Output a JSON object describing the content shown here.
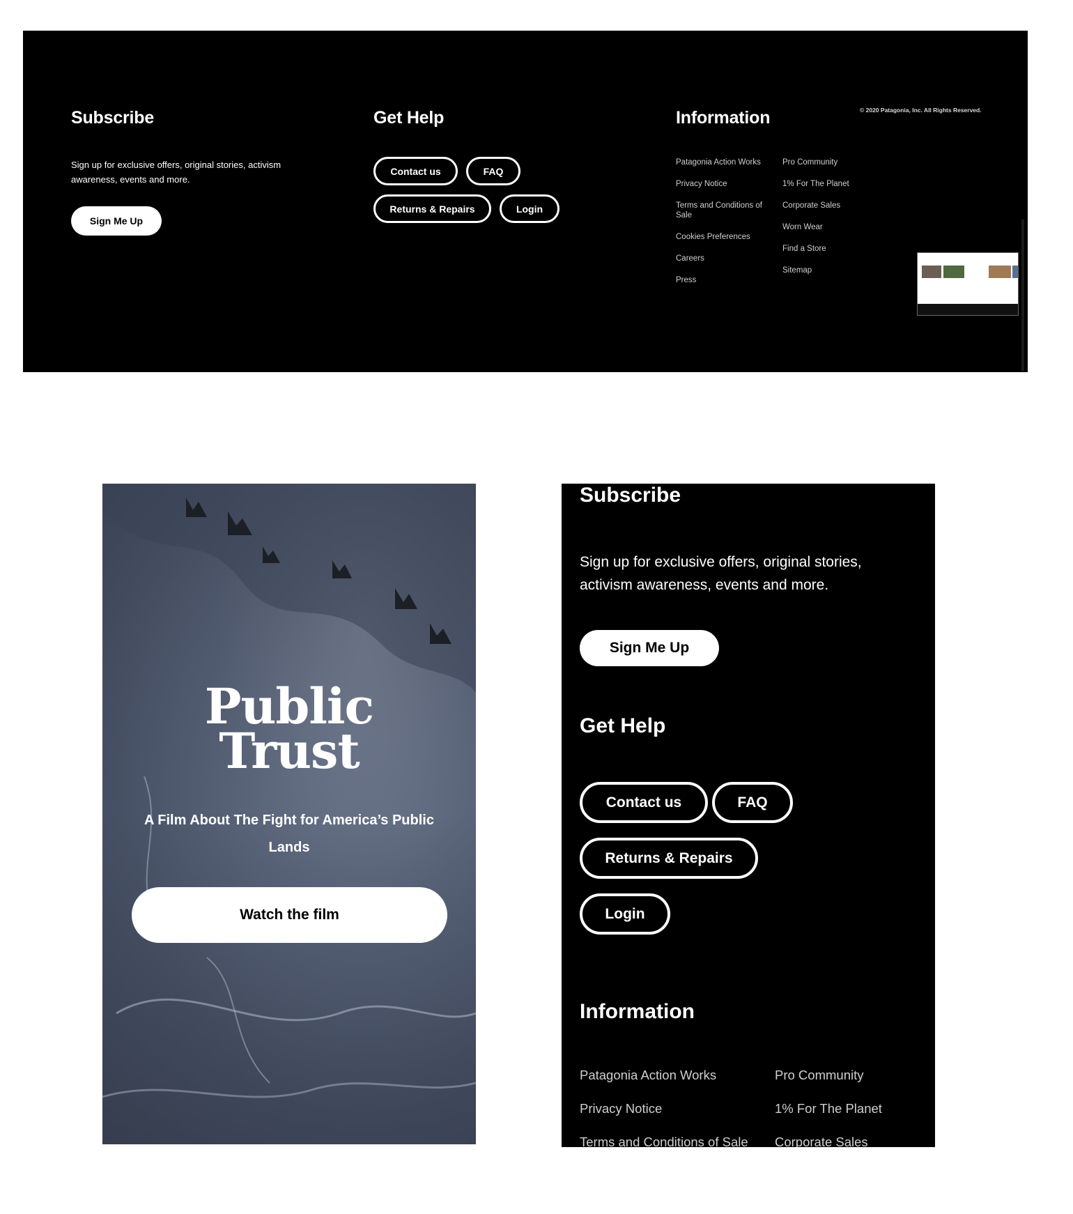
{
  "desktop_footer": {
    "subscribe": {
      "heading": "Subscribe",
      "text": "Sign up for exclusive offers, original stories, activism awareness, events and more.",
      "button": "Sign Me Up"
    },
    "help": {
      "heading": "Get Help",
      "buttons": [
        "Contact us",
        "FAQ",
        "Returns & Repairs",
        "Login"
      ]
    },
    "info": {
      "heading": "Information",
      "col1": [
        "Patagonia Action Works",
        "Privacy Notice",
        "Terms and Conditions of Sale",
        "Cookies Preferences",
        "Careers",
        "Press"
      ],
      "col2": [
        "Pro Community",
        "1% For The Planet",
        "Corporate Sales",
        "Worn Wear",
        "Find a Store",
        "Sitemap"
      ]
    },
    "copyright": "© 2020 Patagonia, Inc. All Rights Reserved."
  },
  "mobile_hero": {
    "title_line1": "Public",
    "title_line2": "Trust",
    "subtitle": "A Film About The Fight for America’s Public Lands",
    "button": "Watch the film"
  },
  "mobile_footer": {
    "subscribe_heading": "Subscribe",
    "subscribe_text": "Sign up for exclusive offers, original stories, activism awareness, events and more.",
    "subscribe_button": "Sign Me Up",
    "help_heading": "Get Help",
    "help_buttons": [
      "Contact us",
      "FAQ",
      "Returns & Repairs",
      "Login"
    ],
    "info_heading": "Information",
    "info_links": [
      "Patagonia Action Works",
      "Pro Community",
      "Privacy Notice",
      "1% For The Planet",
      "Terms and Conditions of Sale",
      "Corporate Sales"
    ]
  }
}
